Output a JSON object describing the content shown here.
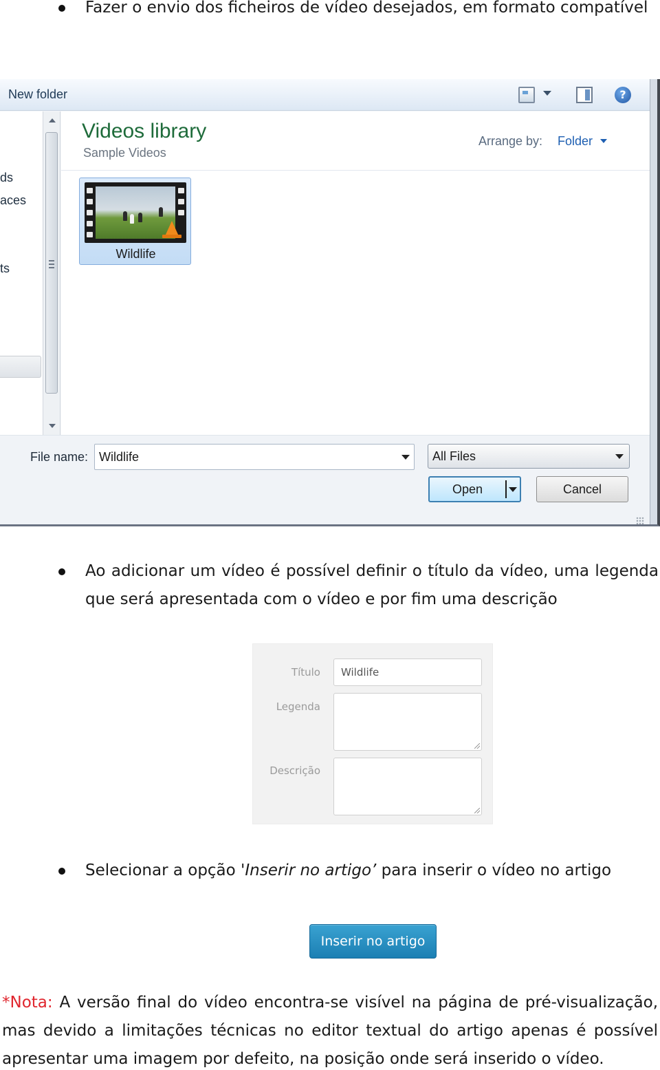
{
  "bullets": [
    {
      "text": "Fazer o envio dos ficheiros de vídeo desejados, em formato compatível"
    },
    {
      "text": "Ao adicionar um vídeo é possível definir o título da vídeo, uma legenda que será apresentada com o vídeo e por fim uma descrição"
    },
    {
      "text_before": "Selecionar a opção '",
      "text_italic": "Inserir no artigo’",
      "text_after": " para inserir o vídeo no artigo"
    }
  ],
  "file_dialog": {
    "toolbar": {
      "new_folder_label": "New folder",
      "icons": [
        "change-view-icon",
        "view-dropdown-icon",
        "preview-pane-icon",
        "help-icon"
      ],
      "help_glyph": "?"
    },
    "nav_items_partial": [
      "ds",
      "aces",
      "ts"
    ],
    "library": {
      "title": "Videos library",
      "subtitle": "Sample Videos",
      "arrange_by_label": "Arrange by:",
      "arrange_by_value": "Folder"
    },
    "files": [
      {
        "name": "Wildlife",
        "type": "video",
        "icon": "vlc-cone-icon",
        "selected": true
      }
    ],
    "footer": {
      "file_name_label": "File name:",
      "file_name_value": "Wildlife",
      "file_type_filter": "All Files",
      "open_button": "Open",
      "cancel_button": "Cancel"
    },
    "colors": {
      "title_green": "#1e6b3a",
      "link_blue": "#1e5fb2",
      "selection": "#c3dcf5"
    }
  },
  "video_form": {
    "fields": [
      {
        "label": "Título",
        "value": "Wildlife"
      },
      {
        "label": "Legenda",
        "value": ""
      },
      {
        "label": "Descrição",
        "value": ""
      }
    ]
  },
  "insert_button": {
    "label": "Inserir no artigo",
    "color": "#2b92c4"
  },
  "note": {
    "prefix": "*Nota:",
    "text": " A versão final do vídeo encontra-se visível na página de pré-visualização, mas devido a limitações técnicas no editor textual do artigo apenas é possível apresentar uma imagem por defeito, na posição onde será inserido o vídeo.",
    "prefix_color": "#e0262e"
  }
}
